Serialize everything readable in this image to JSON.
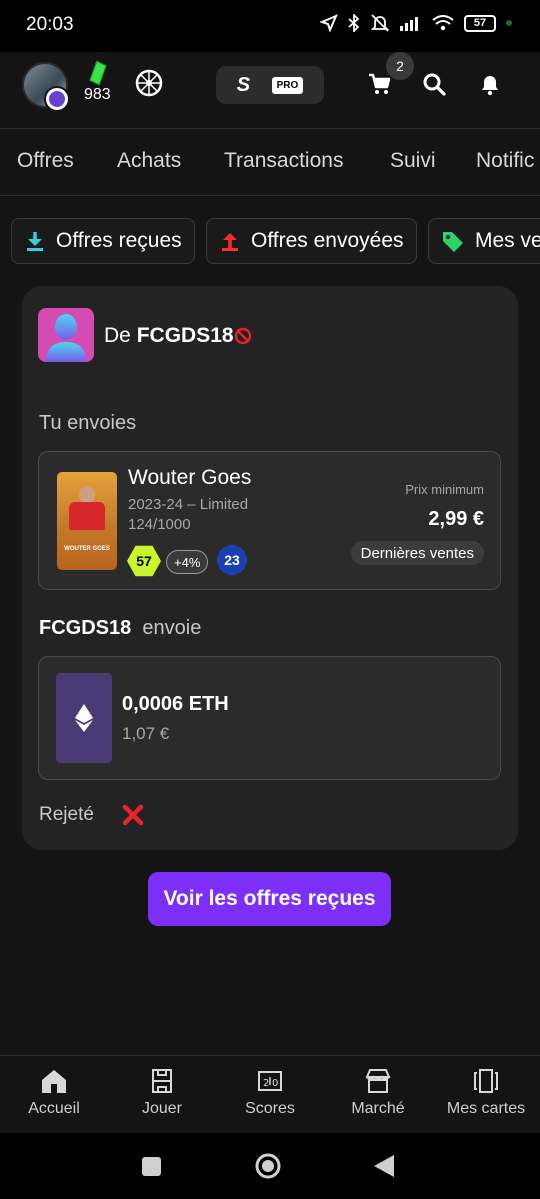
{
  "status_bar": {
    "time": "20:03",
    "battery": "57"
  },
  "header": {
    "coins": "983",
    "mode_logo": "S",
    "mode_pro": "PRO",
    "cart_count": "2"
  },
  "tabs": [
    {
      "label": "Offres"
    },
    {
      "label": "Achats"
    },
    {
      "label": "Transactions"
    },
    {
      "label": "Suivi"
    },
    {
      "label": "Notific"
    }
  ],
  "chips": [
    {
      "label": "Offres reçues",
      "icon": "download-icon",
      "color": "#2fd3e0"
    },
    {
      "label": "Offres envoyées",
      "icon": "upload-icon",
      "color": "#ff2b2b"
    },
    {
      "label": "Mes ve",
      "icon": "tag-icon",
      "color": "#2bd36a"
    }
  ],
  "offer": {
    "from_prefix": "De",
    "from_user": "FCGDS18",
    "you_send_label": "Tu envoies",
    "player": {
      "name": "Wouter Goes",
      "season": "2023-24 – Limited",
      "serial": "124/1000",
      "card_name": "WOUTER GOES",
      "score": "57",
      "bonus": "+4%",
      "number": "23",
      "price_label": "Prix minimum",
      "price": "2,99 €",
      "last_sales": "Dernières ventes"
    },
    "they_send_user": "FCGDS18",
    "they_send_label": "envoie",
    "eth_amount": "0,0006 ETH",
    "eth_eur": "1,07 €",
    "status": "Rejeté"
  },
  "cta_label": "Voir les offres reçues",
  "bottom_nav": [
    {
      "label": "Accueil",
      "icon": "home-icon"
    },
    {
      "label": "Jouer",
      "icon": "play-icon"
    },
    {
      "label": "Scores",
      "icon": "scoreboard-icon"
    },
    {
      "label": "Marché",
      "icon": "store-icon"
    },
    {
      "label": "Mes cartes",
      "icon": "cards-icon"
    }
  ],
  "colors": {
    "accent": "#7b2ff7",
    "reject": "#e8242a",
    "score_badge": "#c9f52d"
  }
}
